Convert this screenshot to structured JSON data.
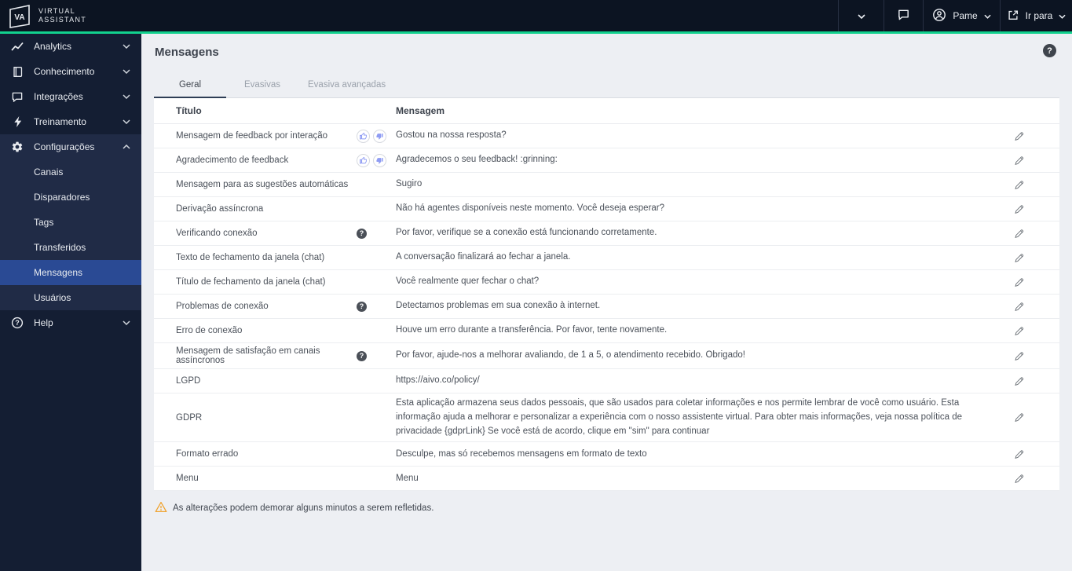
{
  "colors": {
    "accent": "#12d18e",
    "topbar_bg": "#0c1422",
    "sidebar_bg": "#141e33",
    "sidebar_expanded_bg": "#202b46",
    "selected_item_bg": "#2a4a94",
    "content_bg": "#edeff3",
    "warning": "#f0a32f",
    "thumb_icon": "#8f9cf3"
  },
  "topbar": {
    "logo": {
      "monogram": "VA",
      "title_line1": "VIRTUAL",
      "title_line2": "ASSISTANT"
    },
    "user": {
      "name": "Pame"
    },
    "go_to_label": "Ir para"
  },
  "sidebar": {
    "items": [
      {
        "label": "Analytics",
        "icon": "chart"
      },
      {
        "label": "Conhecimento",
        "icon": "book"
      },
      {
        "label": "Integrações",
        "icon": "chat"
      },
      {
        "label": "Treinamento",
        "icon": "bolt"
      },
      {
        "label": "Configurações",
        "icon": "gear",
        "expanded": true,
        "children": [
          {
            "label": "Canais"
          },
          {
            "label": "Disparadores"
          },
          {
            "label": "Tags"
          },
          {
            "label": "Transferidos"
          },
          {
            "label": "Mensagens",
            "selected": true
          },
          {
            "label": "Usuários"
          }
        ]
      },
      {
        "label": "Help",
        "icon": "help"
      }
    ]
  },
  "page": {
    "title": "Mensagens",
    "tabs": [
      {
        "label": "Geral",
        "active": true
      },
      {
        "label": "Evasivas"
      },
      {
        "label": "Evasiva avançadas"
      }
    ],
    "table": {
      "columns": [
        "Título",
        "Mensagem"
      ],
      "rows": [
        {
          "titulo": "Mensagem de feedback por interação",
          "mensagem": "Gostou na nossa resposta?",
          "icons": "thumbs"
        },
        {
          "titulo": "Agradecimento de feedback",
          "mensagem": "Agradecemos o seu feedback! :grinning:",
          "icons": "thumbs"
        },
        {
          "titulo": "Mensagem para as sugestões automáticas",
          "mensagem": "Sugiro"
        },
        {
          "titulo": "Derivação assíncrona",
          "mensagem": "Não há agentes disponíveis neste momento. Você deseja esperar?"
        },
        {
          "titulo": "Verificando conexão",
          "mensagem": "Por favor, verifique se a conexão está funcionando corretamente.",
          "icons": "help"
        },
        {
          "titulo": "Texto de fechamento da janela (chat)",
          "mensagem": "A conversação finalizará ao fechar a janela."
        },
        {
          "titulo": "Título de fechamento da janela (chat)",
          "mensagem": "Você realmente quer fechar o chat?"
        },
        {
          "titulo": "Problemas de conexão",
          "mensagem": "Detectamos problemas em sua conexão à internet.",
          "icons": "help"
        },
        {
          "titulo": "Erro de conexão",
          "mensagem": "Houve um erro durante a transferência. Por favor, tente novamente."
        },
        {
          "titulo": "Mensagem de satisfação em canais assíncronos",
          "mensagem": "Por favor, ajude-nos a melhorar avaliando, de 1 a 5, o atendimento recebido. Obrigado!",
          "icons": "help"
        },
        {
          "titulo": "LGPD",
          "mensagem": "https://aivo.co/policy/"
        },
        {
          "titulo": "GDPR",
          "mensagem": "Esta aplicação armazena seus dados pessoais, que são usados para coletar informações e nos permite lembrar de você como usuário. Esta informação ajuda a melhorar e personalizar a experiência com o nosso assistente virtual. Para obter mais informações, veja nossa política de privacidade {gdprLink} Se você está de acordo, clique em \"sim\" para continuar"
        },
        {
          "titulo": "Formato errado",
          "mensagem": "Desculpe, mas só recebemos mensagens em formato de texto"
        },
        {
          "titulo": "Menu",
          "mensagem": "Menu"
        }
      ]
    },
    "footer_note": "As alterações podem demorar alguns minutos a serem refletidas."
  }
}
